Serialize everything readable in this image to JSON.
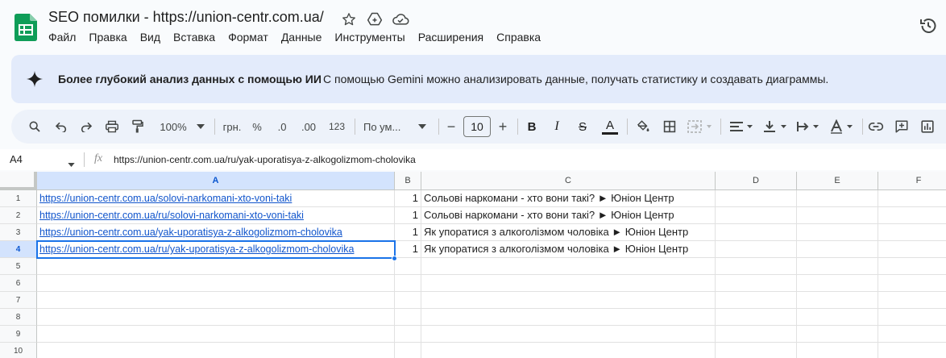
{
  "app": {
    "title": "SEO помилки - https://union-centr.com.ua/",
    "brand_color": "#0f9d58",
    "accent_color": "#0b57d0"
  },
  "menu": [
    "Файл",
    "Правка",
    "Вид",
    "Вставка",
    "Формат",
    "Данные",
    "Инструменты",
    "Расширения",
    "Справка"
  ],
  "banner": {
    "title": "Более глубокий анализ данных с помощью ИИ",
    "text": "С помощью Gemini можно анализировать данные, получать статистику и создавать диаграммы."
  },
  "toolbar": {
    "zoom": "100%",
    "currency": "грн.",
    "percent": "%",
    "decrease_decimals": ".0",
    "increase_decimals": ".00",
    "number_format": "123",
    "font": "По ум...",
    "font_size": "10",
    "minus": "−",
    "plus": "+",
    "bold": "B",
    "italic": "I",
    "strike": "S",
    "text_color": "A"
  },
  "formula_bar": {
    "cell_ref": "A4",
    "fx": "fx",
    "value": "https://union-centr.com.ua/ru/yak-uporatisya-z-alkogolizmom-cholovika"
  },
  "columns": [
    "A",
    "B",
    "C",
    "D",
    "E",
    "F"
  ],
  "rows": [
    "1",
    "2",
    "3",
    "4",
    "5",
    "6",
    "7",
    "8",
    "9",
    "10"
  ],
  "cells": [
    {
      "a": "https://union-centr.com.ua/solovi-narkomani-xto-voni-taki",
      "b": "1",
      "c": "Сольові наркомани - хто вони такі? ► Юніон Центр"
    },
    {
      "a": "https://union-centr.com.ua/ru/solovi-narkomani-xto-voni-taki",
      "b": "1",
      "c": "Сольові наркомани - хто вони такі? ► Юніон Центр"
    },
    {
      "a": "https://union-centr.com.ua/yak-uporatisya-z-alkogolizmom-cholovika",
      "b": "1",
      "c": "Як упоратися з алкоголізмом чоловіка ► Юніон Центр"
    },
    {
      "a": "https://union-centr.com.ua/ru/yak-uporatisya-z-alkogolizmom-cholovika",
      "b": "1",
      "c": "Як упоратися з алкоголізмом чоловіка ► Юніон Центр"
    }
  ],
  "selected": {
    "column": "A",
    "row": "4"
  }
}
